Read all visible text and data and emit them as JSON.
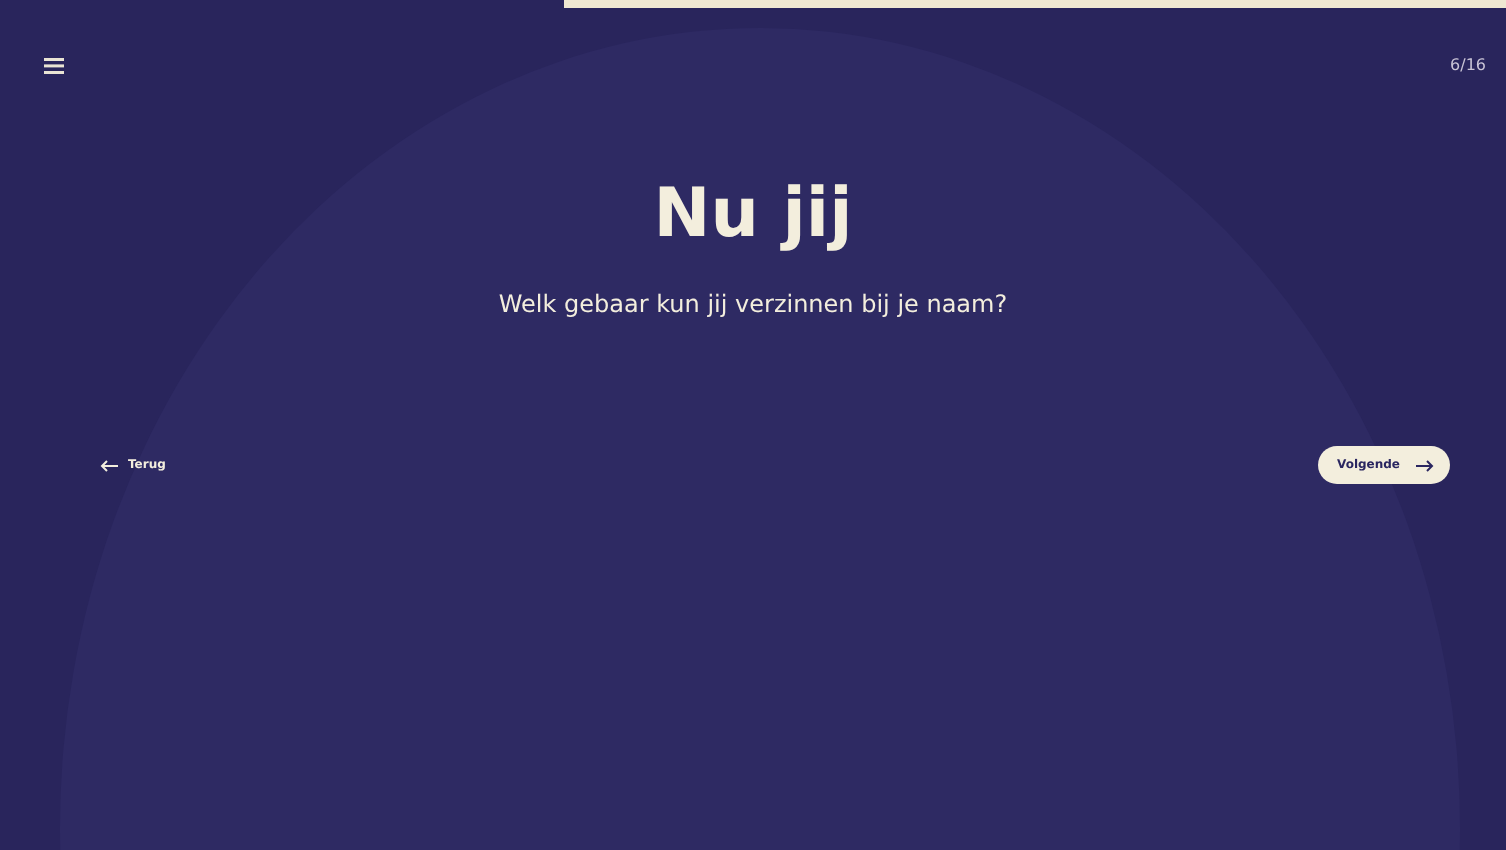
{
  "progress": {
    "level": 0.375
  },
  "header": {
    "counter": "6/16"
  },
  "content": {
    "title": "Nu jij",
    "question": "Welk gebaar kun jij verzinnen bij je naam?"
  },
  "navigation": {
    "back": "Terug",
    "next": "Volgende"
  }
}
